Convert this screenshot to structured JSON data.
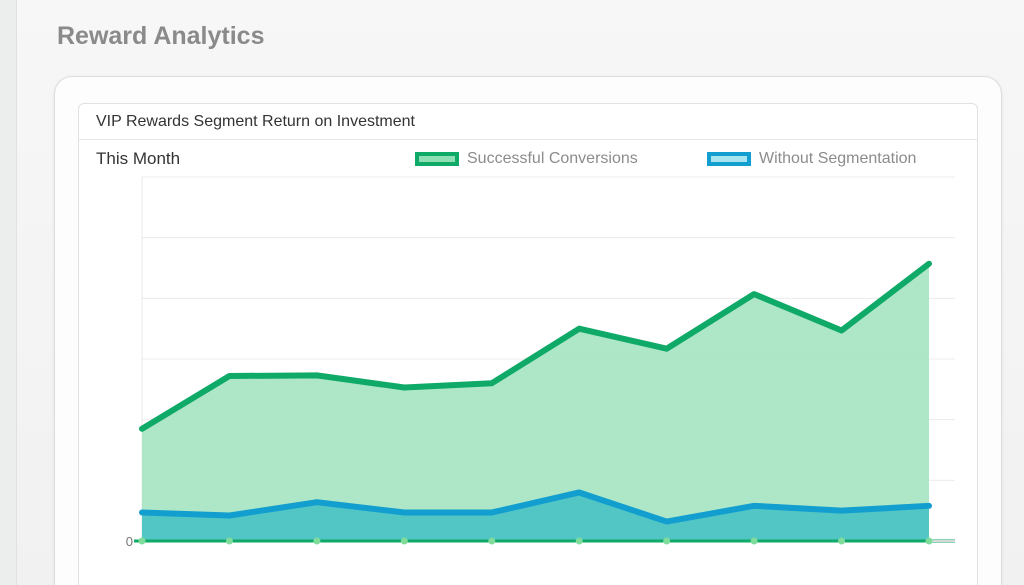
{
  "page": {
    "title": "Reward Analytics"
  },
  "panel": {
    "title": "VIP Rewards Segment Return on Investment",
    "period": "This Month"
  },
  "chart_data": {
    "type": "area",
    "title": "VIP Rewards Segment Return on Investment",
    "subtitle": "This Month",
    "x": [
      1,
      2,
      3,
      4,
      5,
      6,
      7,
      8,
      9,
      10
    ],
    "ylim": [
      0,
      6
    ],
    "y_ticks": [
      "0"
    ],
    "grid": true,
    "legend_position": "top-right",
    "series": [
      {
        "name": "Successful Conversions",
        "color": "#0fa968",
        "fill": "#a9e6c4",
        "values": [
          1.85,
          2.72,
          2.73,
          2.53,
          2.6,
          3.5,
          3.17,
          4.07,
          3.47,
          4.57
        ]
      },
      {
        "name": "Without Segmentation",
        "color": "#129ecf",
        "fill": "#48c2c4",
        "values": [
          0.47,
          0.42,
          0.64,
          0.47,
          0.47,
          0.8,
          0.32,
          0.58,
          0.5,
          0.58
        ]
      }
    ]
  }
}
